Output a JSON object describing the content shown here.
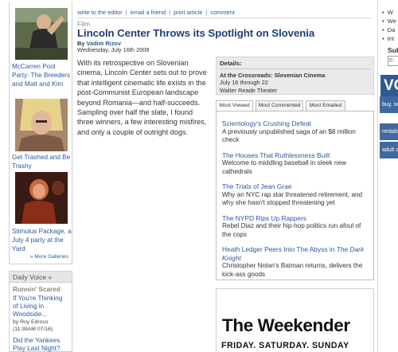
{
  "sidebar": {
    "gallery": [
      {
        "caption": "McCarren Pool Party: The Breeders and Matt and Kim"
      },
      {
        "caption": "Get Trashed and Be Trashy"
      },
      {
        "caption": "Stimulus Package, a July 4 party at the Yard"
      }
    ],
    "more_galleries": "» More Galleries",
    "daily_voice": {
      "header": "Daily Voice «",
      "subheader": "Runnin' Scared",
      "items": [
        {
          "title": "If You're Thinking of Living in Woodside...",
          "byline": "by Roy Edroso",
          "time": "(11:39AM 07/16)"
        },
        {
          "title": "Did the Yankees Play Last Night?",
          "byline": "",
          "time": ""
        }
      ]
    }
  },
  "toolbar": {
    "write_editor": "write to the editor",
    "email_friend": "email a friend",
    "print_article": "print article",
    "comment": "comment",
    "separator": "|"
  },
  "article": {
    "section": "Film",
    "title": "Lincoln Center Throws its Spotlight on Slovenia",
    "by_prefix": "By",
    "author": "Vadim Rizov",
    "date": "Wednesday, July 16th 2008",
    "body": "With its retrospective on Slovenian cinema, Lincoln Center sets out to prove that intelligent cinematic life exists in the post-Communist European landscape beyond Romania—and half-succeeds. Sampling over half the slate, I found three winners, a few interesting misfires, and only a couple of outright dogs."
  },
  "details": {
    "heading": "Details:",
    "event": "At the Crossroads: Slovenian Cinema",
    "dates": "July 16 through 22",
    "venue": "Walter Reade Theater"
  },
  "tabs": {
    "items": [
      "Most Viewed",
      "Most Commented",
      "Most Emailed"
    ],
    "active": "Most Viewed"
  },
  "most_viewed": [
    {
      "title": "Scientology's Crushing Defeat",
      "desc": "A previously unpublished saga of an $8 million check"
    },
    {
      "title": "The Houses That Ruthlessness Built",
      "desc": "Welcome to middling baseball in sleek new cathedrals"
    },
    {
      "title": "The Trials of Jean Grae",
      "desc": "Why an NYC rap star threatened retirement, and why she hasn't stopped threatening yet"
    },
    {
      "title": "The NYPD Rips Up Rappers",
      "desc": "Rebel Diaz and their hip-hop politics run afoul of the cops"
    },
    {
      "title_pre": "Heath Ledger Peers Into The Abyss in ",
      "title_em": "The Dark Knight",
      "desc": "Christopher Nolan's Batman returns, delivers the kick-ass goods"
    }
  ],
  "ad": {
    "headline": "The Weekender",
    "days": "FRIDAY. SATURDAY. SUNDAY"
  },
  "right_edge": {
    "list": [
      "W",
      "We",
      "Da",
      "Int"
    ],
    "subscribe": "Sub",
    "email_placeholder": "E-M",
    "logo": "VO",
    "bars": [
      "buy, se",
      "rentals",
      "adult c"
    ]
  },
  "colors": {
    "link": "#2a5a9e",
    "title": "#1f3f78",
    "details_bg": "#eaeaea",
    "voice_blue": "#2e5a8f"
  }
}
